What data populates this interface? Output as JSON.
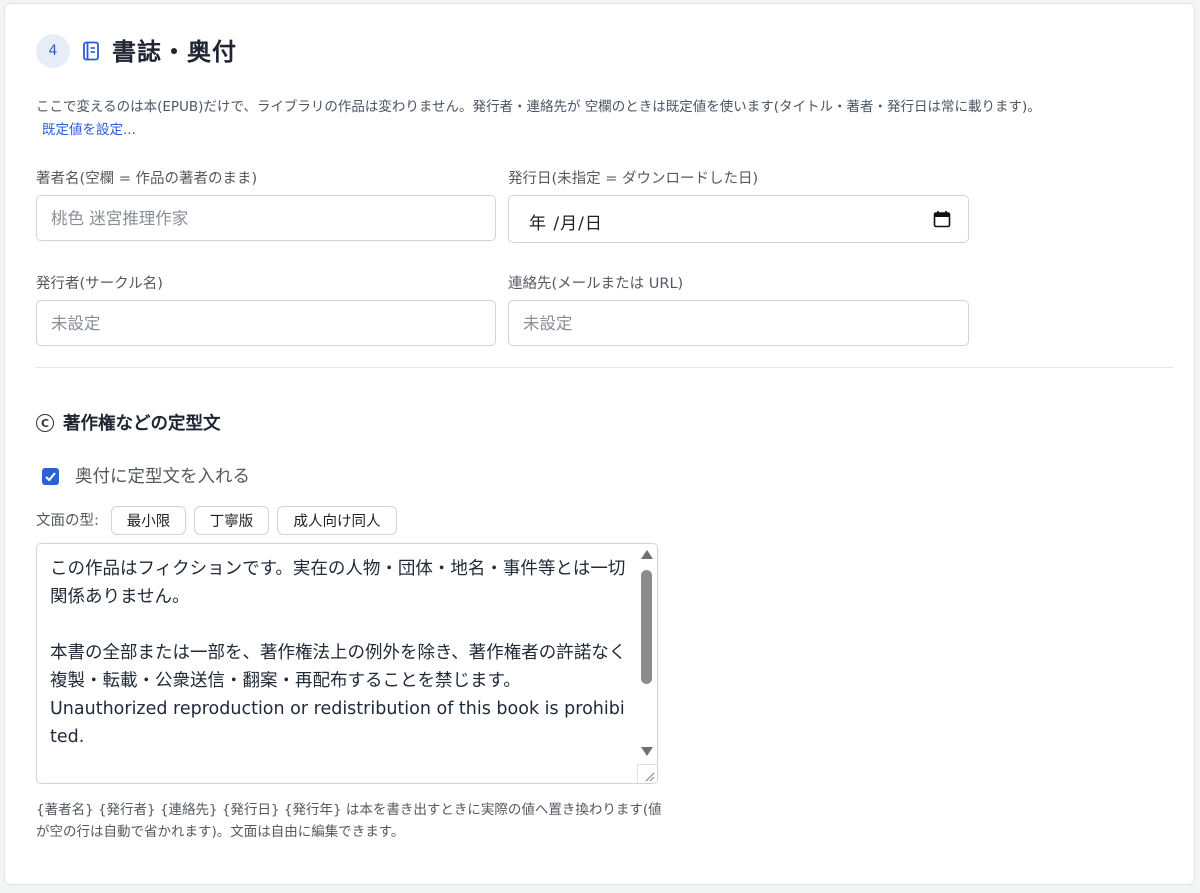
{
  "section": {
    "step_number": "4",
    "title": "書誌・奥付",
    "description": "ここで変えるのは本(EPUB)だけで、ライブラリの作品は変わりません。発行者・連絡先が 空欄のときは既定値を使います(タイトル・著者・発行日は常に載ります)。",
    "defaults_link": "既定値を設定..."
  },
  "fields": {
    "author": {
      "label": "著者名(空欄 = 作品の著者のまま)",
      "placeholder": "桃色 迷宮推理作家"
    },
    "publish_date": {
      "label": "発行日(未指定 = ダウンロードした日)",
      "value_display": "年 /月/日"
    },
    "publisher": {
      "label": "発行者(サークル名)",
      "placeholder": "未設定"
    },
    "contact": {
      "label": "連絡先(メールまたは URL)",
      "placeholder": "未設定"
    }
  },
  "boilerplate": {
    "title": "著作権などの定型文",
    "checkbox_label": "奥付に定型文を入れる",
    "checkbox_checked": true,
    "type_label": "文面の型:",
    "presets": [
      "最小限",
      "丁寧版",
      "成人向け同人"
    ],
    "text": "この作品はフィクションです。実在の人物・団体・地名・事件等とは一切関係ありません。\n\n本書の全部または一部を、著作権法上の例外を除き、著作権者の許諾なく複製・転載・公衆送信・翻案・再配布することを禁じます。\nUnauthorized reproduction or redistribution of this book is prohibited.\n\n© {発行年} {著者名} / {発行者}",
    "help": "{著者名} {発行者} {連絡先} {発行日} {発行年} は本を書き出すときに実際の値へ置き換わります(値が空の行は自動で省かれます)。文面は自由に編集できます。"
  },
  "colors": {
    "accent": "#2a62d4",
    "badge_bg": "#e6edf9",
    "border": "#cfd4da"
  },
  "icons": {
    "section": "book-icon",
    "date": "calendar-icon",
    "copyright": "copyright-icon"
  }
}
